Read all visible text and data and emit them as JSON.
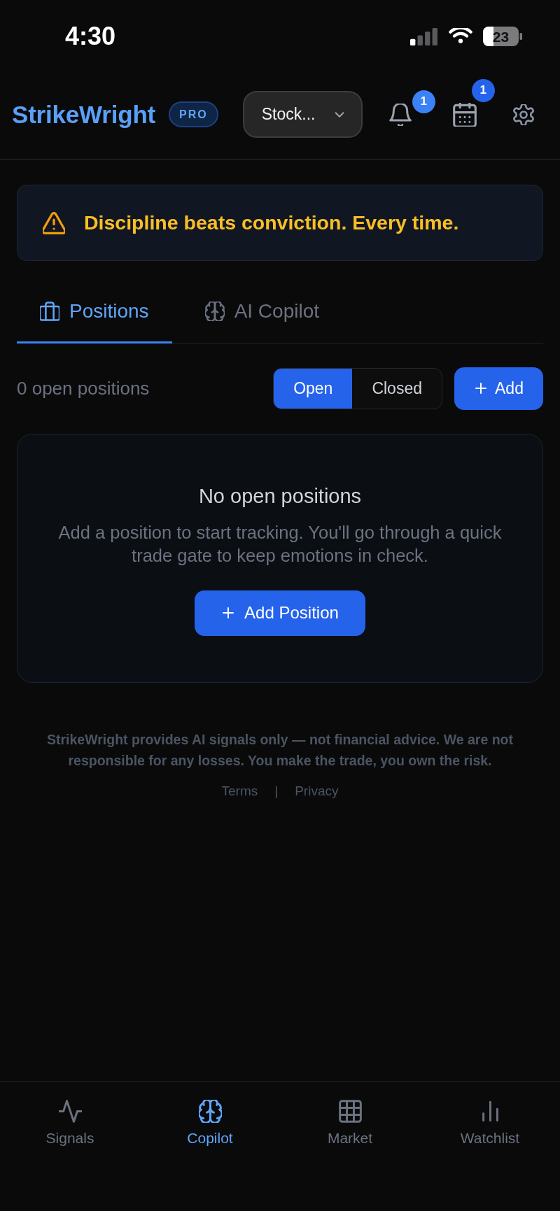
{
  "status_bar": {
    "time": "4:30",
    "battery": "23"
  },
  "header": {
    "logo": "StrikeWright",
    "plan_badge": "PRO",
    "market_select": {
      "value": "Stock..."
    },
    "actions": [
      {
        "kind": "notifications",
        "badge": "1"
      },
      {
        "kind": "calendar",
        "badge": "1"
      },
      {
        "kind": "settings"
      }
    ]
  },
  "banner": {
    "kind": "warning",
    "text": "Discipline beats conviction. Every time."
  },
  "tabs": [
    {
      "kind": "positions",
      "label": "Positions",
      "selected": true
    },
    {
      "kind": "copilot",
      "label": "AI Copilot",
      "selected": false
    }
  ],
  "toolbar": {
    "count": "0 open positions",
    "filters": [
      {
        "label": "Open",
        "selected": true
      },
      {
        "label": "Closed",
        "selected": false
      }
    ],
    "add_button": "Add"
  },
  "empty_state": {
    "title": "No open positions",
    "description": "Add a position to start tracking. You'll go through a quick trade gate to keep emotions in check.",
    "button": "Add Position"
  },
  "footer": {
    "disclaimer": "StrikeWright provides AI signals only — not financial advice. We are not responsible for any losses. You make the trade, you own the risk.",
    "links": [
      "Terms",
      "Privacy"
    ],
    "separator": "|"
  },
  "bottom_nav": [
    {
      "kind": "signals",
      "label": "Signals",
      "selected": false
    },
    {
      "kind": "copilot",
      "label": "Copilot",
      "selected": true
    },
    {
      "kind": "market",
      "label": "Market",
      "selected": false
    },
    {
      "kind": "watchlist",
      "label": "Watchlist",
      "selected": false
    }
  ]
}
